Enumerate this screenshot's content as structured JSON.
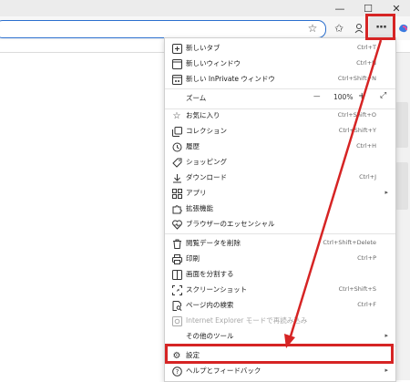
{
  "window": {
    "minimize_glyph": "—",
    "maximize_glyph": "☐",
    "close_glyph": "✕"
  },
  "toolbar": {
    "more_glyph": "···",
    "favorite_glyph": "☆",
    "collections_glyph": "✩"
  },
  "menu": {
    "new_tab": {
      "label": "新しいタブ",
      "shortcut": "Ctrl+T"
    },
    "new_window": {
      "label": "新しいウィンドウ",
      "shortcut": "Ctrl+N"
    },
    "new_private": {
      "label": "新しい InPrivate ウィンドウ",
      "shortcut": "Ctrl+Shift+N"
    },
    "zoom": {
      "label": "ズーム",
      "minus": "—",
      "value": "100%",
      "plus": "+",
      "fullscreen": "⤢"
    },
    "favorites": {
      "label": "お気に入り",
      "shortcut": "Ctrl+Shift+O"
    },
    "collections": {
      "label": "コレクション",
      "shortcut": "Ctrl+Shift+Y"
    },
    "history": {
      "label": "履歴",
      "shortcut": "Ctrl+H"
    },
    "shopping": {
      "label": "ショッピング"
    },
    "downloads": {
      "label": "ダウンロード",
      "shortcut": "Ctrl+J"
    },
    "apps": {
      "label": "アプリ",
      "arrow": "▸"
    },
    "extensions": {
      "label": "拡張機能"
    },
    "essentials": {
      "label": "ブラウザーのエッセンシャル"
    },
    "clear_data": {
      "label": "閲覧データを削除",
      "shortcut": "Ctrl+Shift+Delete"
    },
    "print": {
      "label": "印刷",
      "shortcut": "Ctrl+P"
    },
    "split_screen": {
      "label": "画面を分割する"
    },
    "screenshot": {
      "label": "スクリーンショット",
      "shortcut": "Ctrl+Shift+S"
    },
    "find": {
      "label": "ページ内の検索",
      "shortcut": "Ctrl+F"
    },
    "ie_mode": {
      "label": "Internet Explorer モードで再読み込み"
    },
    "more_tools": {
      "label": "その他のツール",
      "arrow": "▸"
    },
    "settings": {
      "label": "設定"
    },
    "help": {
      "label": "ヘルプとフィードバック",
      "arrow": "▸"
    }
  },
  "colors": {
    "annotation_red": "#d62424",
    "address_border": "#2b6fce"
  }
}
